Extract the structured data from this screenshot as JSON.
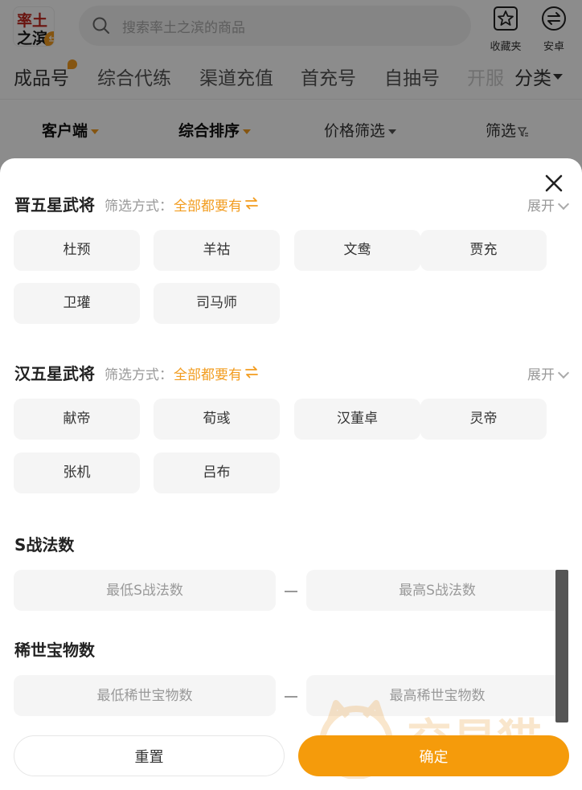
{
  "header": {
    "logo_line1": "率土",
    "logo_line2": "之滨",
    "logo_badge": "⇆",
    "search_placeholder": "搜索率土之滨的商品",
    "favorites_label": "收藏夹",
    "platform_label": "安卓"
  },
  "categories": [
    "成品号",
    "综合代练",
    "渠道充值",
    "首充号",
    "自抽号",
    "开服"
  ],
  "category_more": "分类",
  "sort_bar": {
    "client": "客户端",
    "sort": "综合排序",
    "price": "价格筛选",
    "filter": "筛选"
  },
  "sheet": {
    "sections": [
      {
        "title": "晋五星武将",
        "filter_label": "筛选方式：",
        "filter_mode": "全部都要有",
        "expand": "展开",
        "chips": [
          "杜预",
          "羊祜",
          "文鸯",
          "贾充",
          "卫瓘",
          "司马师"
        ]
      },
      {
        "title": "汉五星武将",
        "filter_label": "筛选方式：",
        "filter_mode": "全部都要有",
        "expand": "展开",
        "chips": [
          "献帝",
          "荀彧",
          "汉董卓",
          "灵帝",
          "张机",
          "吕布"
        ]
      }
    ],
    "ranges": [
      {
        "title": "S战法数",
        "min_placeholder": "最低S战法数",
        "max_placeholder": "最高S战法数"
      },
      {
        "title": "稀世宝物数",
        "min_placeholder": "最低稀世宝物数",
        "max_placeholder": "最高稀世宝物数"
      }
    ],
    "reset_label": "重置",
    "confirm_label": "确定",
    "watermark_text": "交易猫"
  },
  "colors": {
    "accent": "#f29c1f",
    "confirm": "#f59b0b",
    "chip_bg": "#f5f5f5"
  }
}
